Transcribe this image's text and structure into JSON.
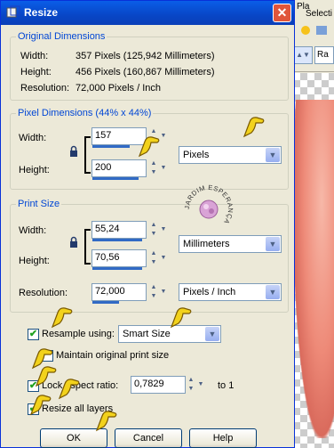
{
  "window": {
    "title": "Resize",
    "close_symbol": "✕"
  },
  "background_app": {
    "label_top": "Pla",
    "label_select": "Selecti",
    "field_value": "Ra"
  },
  "original_dimensions": {
    "legend": "Original Dimensions",
    "width_label": "Width:",
    "width_value": "357 Pixels (125,942 Millimeters)",
    "height_label": "Height:",
    "height_value": "456 Pixels (160,867 Millimeters)",
    "resolution_label": "Resolution:",
    "resolution_value": "72,000 Pixels / Inch"
  },
  "pixel_dimensions": {
    "legend": "Pixel Dimensions (44% x 44%)",
    "width_label": "Width:",
    "width_value": "157",
    "height_label": "Height:",
    "height_value": "200",
    "units_value": "Pixels"
  },
  "print_size": {
    "legend": "Print Size",
    "width_label": "Width:",
    "width_value": "55,24",
    "height_label": "Height:",
    "height_value": "70,56",
    "units_value": "Millimeters",
    "resolution_label": "Resolution:",
    "resolution_value": "72,000",
    "resolution_units": "Pixels / Inch"
  },
  "options": {
    "resample_label": "Resample using:",
    "resample_value": "Smart Size",
    "resample_checked": true,
    "maintain_label": "Maintain original print size",
    "maintain_checked": false,
    "lock_label": "Lock aspect ratio:",
    "lock_value": "0,7829",
    "lock_suffix": "to 1",
    "lock_checked": true,
    "resize_layers_label": "Resize all layers",
    "resize_layers_checked": true
  },
  "buttons": {
    "ok": "OK",
    "cancel": "Cancel",
    "help": "Help"
  },
  "watermark": {
    "text": "JARDIM ESPERANÇA"
  },
  "colors": {
    "accent": "#0046d5",
    "title_bar": "#0846c6",
    "close": "#e0553a",
    "pointer_hand": "#f2d21c"
  },
  "icons": [
    "resize-app-icon",
    "close-icon",
    "chain-lock-icon",
    "spin-arrows-icon",
    "dropdown-arrow-icon",
    "checkmark-icon",
    "pointer-hand-icon",
    "watermark-seal"
  ]
}
